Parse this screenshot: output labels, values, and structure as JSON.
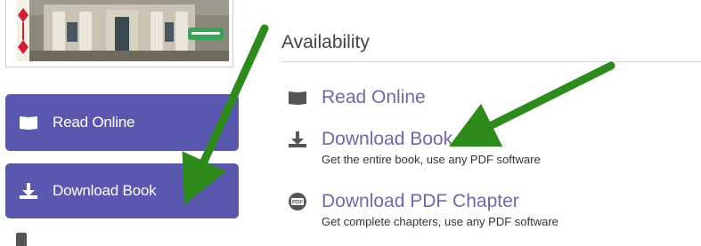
{
  "availability": {
    "title": "Availability",
    "items": [
      {
        "icon": "open-book-icon",
        "label": "Read Online",
        "description": ""
      },
      {
        "icon": "download-icon",
        "label": "Download Book",
        "description": "Get the entire book, use any PDF software"
      },
      {
        "icon": "pdf-file-icon",
        "label": "Download PDF Chapter",
        "description": "Get complete chapters, use any PDF software"
      }
    ]
  },
  "sidebar": {
    "buttons": [
      {
        "icon": "open-book-icon",
        "label": "Read Online"
      },
      {
        "icon": "download-icon",
        "label": "Download Book"
      }
    ]
  },
  "colors": {
    "button_bg": "#5a57ae",
    "link": "#6d6aa8",
    "arrow": "#2f8a1c"
  }
}
